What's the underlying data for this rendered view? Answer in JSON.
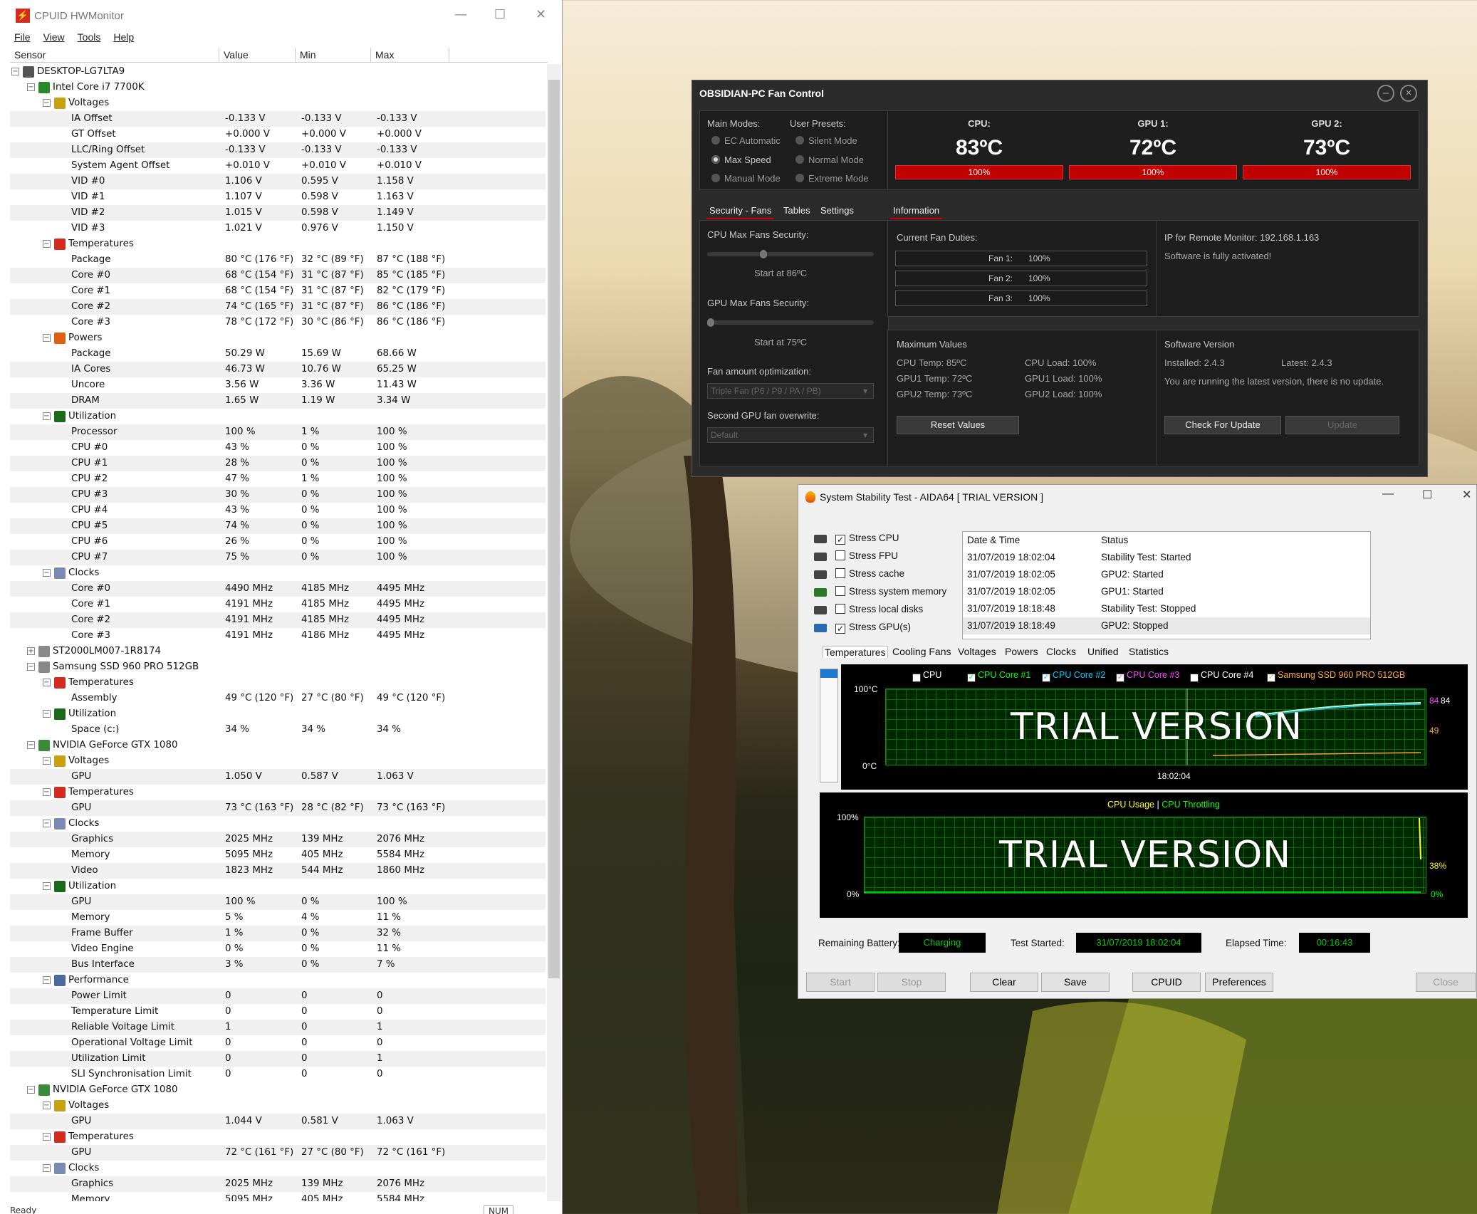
{
  "hwmonitor": {
    "title": "CPUID HWMonitor",
    "menu": [
      "File",
      "View",
      "Tools",
      "Help"
    ],
    "columns": [
      "Sensor",
      "Value",
      "Min",
      "Max"
    ],
    "rows": [
      {
        "lvl": 0,
        "t": "node",
        "icon": "computer-icon",
        "name": "DESKTOP-LG7LTA9"
      },
      {
        "lvl": 1,
        "t": "node",
        "icon": "cpu-chip-icon",
        "name": "Intel Core i7 7700K"
      },
      {
        "lvl": 2,
        "t": "node",
        "icon": "voltage-icon",
        "name": "Voltages"
      },
      {
        "lvl": 3,
        "name": "IA Offset",
        "v": "-0.133 V",
        "mi": "-0.133 V",
        "ma": "-0.133 V"
      },
      {
        "lvl": 3,
        "name": "GT Offset",
        "v": "+0.000 V",
        "mi": "+0.000 V",
        "ma": "+0.000 V"
      },
      {
        "lvl": 3,
        "name": "LLC/Ring Offset",
        "v": "-0.133 V",
        "mi": "-0.133 V",
        "ma": "-0.133 V"
      },
      {
        "lvl": 3,
        "name": "System Agent Offset",
        "v": "+0.010 V",
        "mi": "+0.010 V",
        "ma": "+0.010 V"
      },
      {
        "lvl": 3,
        "name": "VID #0",
        "v": "1.106 V",
        "mi": "0.595 V",
        "ma": "1.158 V"
      },
      {
        "lvl": 3,
        "name": "VID #1",
        "v": "1.107 V",
        "mi": "0.598 V",
        "ma": "1.163 V"
      },
      {
        "lvl": 3,
        "name": "VID #2",
        "v": "1.015 V",
        "mi": "0.598 V",
        "ma": "1.149 V"
      },
      {
        "lvl": 3,
        "name": "VID #3",
        "v": "1.021 V",
        "mi": "0.976 V",
        "ma": "1.150 V"
      },
      {
        "lvl": 2,
        "t": "node",
        "icon": "thermometer-icon",
        "name": "Temperatures"
      },
      {
        "lvl": 3,
        "name": "Package",
        "v": "80 °C (176 °F)",
        "mi": "32 °C (89 °F)",
        "ma": "87 °C (188 °F)"
      },
      {
        "lvl": 3,
        "name": "Core #0",
        "v": "68 °C (154 °F)",
        "mi": "31 °C (87 °F)",
        "ma": "85 °C (185 °F)"
      },
      {
        "lvl": 3,
        "name": "Core #1",
        "v": "68 °C (154 °F)",
        "mi": "31 °C (87 °F)",
        "ma": "82 °C (179 °F)"
      },
      {
        "lvl": 3,
        "name": "Core #2",
        "v": "74 °C (165 °F)",
        "mi": "31 °C (87 °F)",
        "ma": "86 °C (186 °F)"
      },
      {
        "lvl": 3,
        "name": "Core #3",
        "v": "78 °C (172 °F)",
        "mi": "30 °C (86 °F)",
        "ma": "86 °C (186 °F)"
      },
      {
        "lvl": 2,
        "t": "node",
        "icon": "power-icon",
        "name": "Powers"
      },
      {
        "lvl": 3,
        "name": "Package",
        "v": "50.29 W",
        "mi": "15.69 W",
        "ma": "68.66 W"
      },
      {
        "lvl": 3,
        "name": "IA Cores",
        "v": "46.73 W",
        "mi": "10.76 W",
        "ma": "65.25 W"
      },
      {
        "lvl": 3,
        "name": "Uncore",
        "v": "3.56 W",
        "mi": "3.36 W",
        "ma": "11.43 W"
      },
      {
        "lvl": 3,
        "name": "DRAM",
        "v": "1.65 W",
        "mi": "1.19 W",
        "ma": "3.34 W"
      },
      {
        "lvl": 2,
        "t": "node",
        "icon": "utilization-icon",
        "name": "Utilization"
      },
      {
        "lvl": 3,
        "name": "Processor",
        "v": "100 %",
        "mi": "1 %",
        "ma": "100 %"
      },
      {
        "lvl": 3,
        "name": "CPU #0",
        "v": "43 %",
        "mi": "0 %",
        "ma": "100 %"
      },
      {
        "lvl": 3,
        "name": "CPU #1",
        "v": "28 %",
        "mi": "0 %",
        "ma": "100 %"
      },
      {
        "lvl": 3,
        "name": "CPU #2",
        "v": "47 %",
        "mi": "1 %",
        "ma": "100 %"
      },
      {
        "lvl": 3,
        "name": "CPU #3",
        "v": "30 %",
        "mi": "0 %",
        "ma": "100 %"
      },
      {
        "lvl": 3,
        "name": "CPU #4",
        "v": "43 %",
        "mi": "0 %",
        "ma": "100 %"
      },
      {
        "lvl": 3,
        "name": "CPU #5",
        "v": "74 %",
        "mi": "0 %",
        "ma": "100 %"
      },
      {
        "lvl": 3,
        "name": "CPU #6",
        "v": "26 %",
        "mi": "0 %",
        "ma": "100 %"
      },
      {
        "lvl": 3,
        "name": "CPU #7",
        "v": "75 %",
        "mi": "0 %",
        "ma": "100 %"
      },
      {
        "lvl": 2,
        "t": "node",
        "icon": "clock-icon",
        "name": "Clocks"
      },
      {
        "lvl": 3,
        "name": "Core #0",
        "v": "4490 MHz",
        "mi": "4185 MHz",
        "ma": "4495 MHz"
      },
      {
        "lvl": 3,
        "name": "Core #1",
        "v": "4191 MHz",
        "mi": "4185 MHz",
        "ma": "4495 MHz"
      },
      {
        "lvl": 3,
        "name": "Core #2",
        "v": "4191 MHz",
        "mi": "4185 MHz",
        "ma": "4495 MHz"
      },
      {
        "lvl": 3,
        "name": "Core #3",
        "v": "4191 MHz",
        "mi": "4186 MHz",
        "ma": "4495 MHz"
      },
      {
        "lvl": 1,
        "t": "node",
        "collapsed": true,
        "icon": "hdd-icon",
        "name": "ST2000LM007-1R8174"
      },
      {
        "lvl": 1,
        "t": "node",
        "icon": "hdd-icon",
        "name": "Samsung SSD 960 PRO 512GB"
      },
      {
        "lvl": 2,
        "t": "node",
        "icon": "thermometer-icon",
        "name": "Temperatures"
      },
      {
        "lvl": 3,
        "name": "Assembly",
        "v": "49 °C (120 °F)",
        "mi": "27 °C (80 °F)",
        "ma": "49 °C (120 °F)"
      },
      {
        "lvl": 2,
        "t": "node",
        "icon": "utilization-icon",
        "name": "Utilization"
      },
      {
        "lvl": 3,
        "name": "Space (c:)",
        "v": "34 %",
        "mi": "34 %",
        "ma": "34 %"
      },
      {
        "lvl": 1,
        "t": "node",
        "icon": "gpu-icon",
        "name": "NVIDIA GeForce GTX 1080"
      },
      {
        "lvl": 2,
        "t": "node",
        "icon": "voltage-icon",
        "name": "Voltages"
      },
      {
        "lvl": 3,
        "name": "GPU",
        "v": "1.050 V",
        "mi": "0.587 V",
        "ma": "1.063 V"
      },
      {
        "lvl": 2,
        "t": "node",
        "icon": "thermometer-icon",
        "name": "Temperatures"
      },
      {
        "lvl": 3,
        "name": "GPU",
        "v": "73 °C (163 °F)",
        "mi": "28 °C (82 °F)",
        "ma": "73 °C (163 °F)"
      },
      {
        "lvl": 2,
        "t": "node",
        "icon": "clock-icon",
        "name": "Clocks"
      },
      {
        "lvl": 3,
        "name": "Graphics",
        "v": "2025 MHz",
        "mi": "139 MHz",
        "ma": "2076 MHz"
      },
      {
        "lvl": 3,
        "name": "Memory",
        "v": "5095 MHz",
        "mi": "405 MHz",
        "ma": "5584 MHz"
      },
      {
        "lvl": 3,
        "name": "Video",
        "v": "1823 MHz",
        "mi": "544 MHz",
        "ma": "1860 MHz"
      },
      {
        "lvl": 2,
        "t": "node",
        "icon": "utilization-icon",
        "name": "Utilization"
      },
      {
        "lvl": 3,
        "name": "GPU",
        "v": "100 %",
        "mi": "0 %",
        "ma": "100 %"
      },
      {
        "lvl": 3,
        "name": "Memory",
        "v": "5 %",
        "mi": "4 %",
        "ma": "11 %"
      },
      {
        "lvl": 3,
        "name": "Frame Buffer",
        "v": "1 %",
        "mi": "0 %",
        "ma": "32 %"
      },
      {
        "lvl": 3,
        "name": "Video Engine",
        "v": "0 %",
        "mi": "0 %",
        "ma": "11 %"
      },
      {
        "lvl": 3,
        "name": "Bus Interface",
        "v": "3 %",
        "mi": "0 %",
        "ma": "7 %"
      },
      {
        "lvl": 2,
        "t": "node",
        "icon": "gauge-icon",
        "name": "Performance"
      },
      {
        "lvl": 3,
        "name": "Power Limit",
        "v": "0",
        "mi": "0",
        "ma": "0"
      },
      {
        "lvl": 3,
        "name": "Temperature Limit",
        "v": "0",
        "mi": "0",
        "ma": "0"
      },
      {
        "lvl": 3,
        "name": "Reliable Voltage Limit",
        "v": "1",
        "mi": "0",
        "ma": "1"
      },
      {
        "lvl": 3,
        "name": "Operational Voltage Limit",
        "v": "0",
        "mi": "0",
        "ma": "0"
      },
      {
        "lvl": 3,
        "name": "Utilization Limit",
        "v": "0",
        "mi": "0",
        "ma": "1"
      },
      {
        "lvl": 3,
        "name": "SLI Synchronisation Limit",
        "v": "0",
        "mi": "0",
        "ma": "0"
      },
      {
        "lvl": 1,
        "t": "node",
        "icon": "gpu-icon",
        "name": "NVIDIA GeForce GTX 1080"
      },
      {
        "lvl": 2,
        "t": "node",
        "icon": "voltage-icon",
        "name": "Voltages"
      },
      {
        "lvl": 3,
        "name": "GPU",
        "v": "1.044 V",
        "mi": "0.581 V",
        "ma": "1.063 V"
      },
      {
        "lvl": 2,
        "t": "node",
        "icon": "thermometer-icon",
        "name": "Temperatures"
      },
      {
        "lvl": 3,
        "name": "GPU",
        "v": "72 °C (161 °F)",
        "mi": "27 °C (80 °F)",
        "ma": "72 °C (161 °F)"
      },
      {
        "lvl": 2,
        "t": "node",
        "icon": "clock-icon",
        "name": "Clocks"
      },
      {
        "lvl": 3,
        "name": "Graphics",
        "v": "2025 MHz",
        "mi": "139 MHz",
        "ma": "2076 MHz"
      },
      {
        "lvl": 3,
        "name": "Memory",
        "v": "5095 MHz",
        "mi": "405 MHz",
        "ma": "5584 MHz"
      }
    ],
    "status": "Ready",
    "status_num": "NUM"
  },
  "fan": {
    "title": "OBSIDIAN-PC Fan Control",
    "main_modes_label": "Main Modes:",
    "user_presets_label": "User Presets:",
    "modes": [
      "EC Automatic",
      "Max Speed",
      "Manual Mode"
    ],
    "presets": [
      "Silent Mode",
      "Normal Mode",
      "Extreme Mode"
    ],
    "selected_mode": "Max Speed",
    "temps": [
      {
        "label": "CPU:",
        "value": "83ºC",
        "duty": "100%"
      },
      {
        "label": "GPU 1:",
        "value": "72ºC",
        "duty": "100%"
      },
      {
        "label": "GPU 2:",
        "value": "73ºC",
        "duty": "100%"
      }
    ],
    "tabs": [
      "Security - Fans",
      "Tables",
      "Settings"
    ],
    "info_tab": "Information",
    "cpu_security_label": "CPU Max Fans Security:",
    "cpu_start": "Start at 86ºC",
    "gpu_security_label": "GPU Max Fans Security:",
    "gpu_start": "Start at 75ºC",
    "fan_opt_label": "Fan amount optimization:",
    "fan_opt_value": "Triple Fan (P6 / P9 / PA / PB)",
    "second_gpu_label": "Second GPU fan overwrite:",
    "second_gpu_value": "Default",
    "duties_label": "Current Fan Duties:",
    "duties": [
      {
        "name": "Fan 1:",
        "value": "100%"
      },
      {
        "name": "Fan 2:",
        "value": "100%"
      },
      {
        "name": "Fan 3:",
        "value": "100%"
      }
    ],
    "remote_label": "IP for Remote Monitor: 192.168.1.163",
    "activated": "Software is fully activated!",
    "max_label": "Maximum Values",
    "max_left": [
      "CPU Temp: 85ºC",
      "GPU1 Temp: 72ºC",
      "GPU2 Temp: 73ºC"
    ],
    "max_right": [
      "CPU Load: 100%",
      "GPU1 Load: 100%",
      "GPU2 Load: 100%"
    ],
    "reset": "Reset Values",
    "version_label": "Software Version",
    "installed": "Installed: 2.4.3",
    "latest": "Latest: 2.4.3",
    "update_msg": "You are running the latest version, there is no update.",
    "check": "Check For Update",
    "update": "Update"
  },
  "aida": {
    "title": "System Stability Test - AIDA64  [ TRIAL VERSION ]",
    "options": [
      {
        "label": "Stress CPU",
        "checked": true
      },
      {
        "label": "Stress FPU",
        "checked": false
      },
      {
        "label": "Stress cache",
        "checked": false
      },
      {
        "label": "Stress system memory",
        "checked": false
      },
      {
        "label": "Stress local disks",
        "checked": false
      },
      {
        "label": "Stress GPU(s)",
        "checked": true
      }
    ],
    "log_headers": [
      "Date & Time",
      "Status"
    ],
    "log": [
      [
        "31/07/2019 18:02:04",
        "Stability Test: Started"
      ],
      [
        "31/07/2019 18:02:05",
        "GPU2: Started"
      ],
      [
        "31/07/2019 18:02:05",
        "GPU1: Started"
      ],
      [
        "31/07/2019 18:18:48",
        "Stability Test: Stopped"
      ],
      [
        "31/07/2019 18:18:49",
        "GPU2: Stopped"
      ]
    ],
    "tabs": [
      "Temperatures",
      "Cooling Fans",
      "Voltages",
      "Powers",
      "Clocks",
      "Unified",
      "Statistics"
    ],
    "legend": [
      {
        "label": "CPU",
        "color": "#ffffff"
      },
      {
        "label": "CPU Core #1",
        "color": "#00ff00"
      },
      {
        "label": "CPU Core #2",
        "color": "#00c8ff"
      },
      {
        "label": "CPU Core #3",
        "color": "#ff40ff"
      },
      {
        "label": "CPU Core #4",
        "color": "#ffffff"
      },
      {
        "label": "Samsung SSD 960 PRO 512GB",
        "color": "#ffa030"
      }
    ],
    "g1_top": "100°C",
    "g1_bot": "0°C",
    "g1_time": "18:02:04",
    "g1_r1": "84",
    "g1_r2": "84",
    "g1_r3": "49",
    "trial": "TRIAL VERSION",
    "g2_title_a": "CPU Usage",
    "g2_sep": "|",
    "g2_title_b": "CPU Throttling",
    "g2_top": "100%",
    "g2_bot": "0%",
    "g2_r1": "38%",
    "g2_r2": "0%",
    "battery_label": "Remaining Battery:",
    "battery": "Charging",
    "started_label": "Test Started:",
    "started": "31/07/2019 18:02:04",
    "elapsed_label": "Elapsed Time:",
    "elapsed": "00:16:43",
    "buttons": [
      "Start",
      "Stop",
      "Clear",
      "Save",
      "CPUID",
      "Preferences",
      "Close"
    ]
  }
}
